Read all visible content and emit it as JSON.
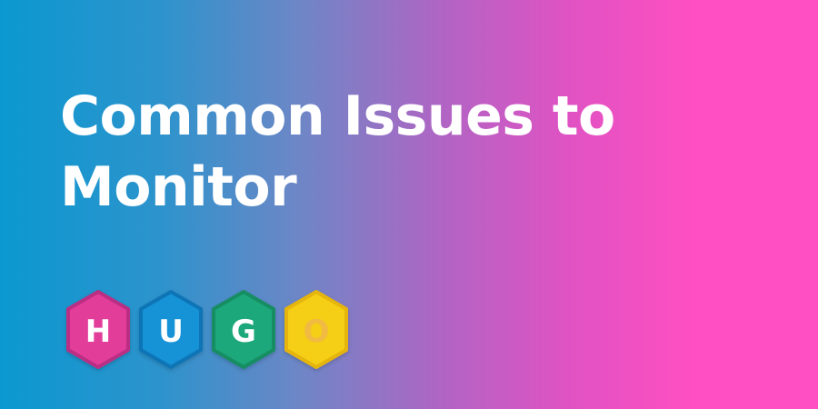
{
  "title": {
    "line1": "Common Issues to",
    "line2": "Monitor"
  },
  "logo": {
    "letters": [
      {
        "char": "H",
        "fill": "#e33d9a",
        "stroke": "#ba2e83",
        "text": "#ffffff"
      },
      {
        "char": "U",
        "fill": "#1792d7",
        "stroke": "#0f75b6",
        "text": "#ffffff"
      },
      {
        "char": "G",
        "fill": "#1fa87a",
        "stroke": "#168d62",
        "text": "#ffffff"
      },
      {
        "char": "O",
        "fill": "#f5ce13",
        "stroke": "#e6b50b",
        "text": "#f1ba42"
      }
    ]
  }
}
